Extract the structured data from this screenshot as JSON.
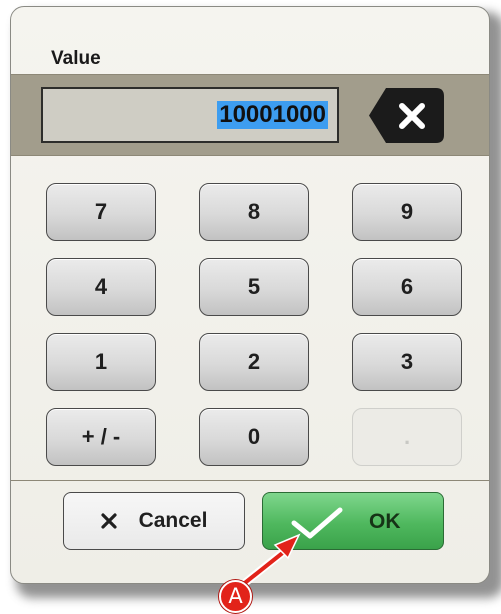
{
  "dialog": {
    "field_label": "Value",
    "value_display": "10001000",
    "value_selected": true,
    "backspace_icon": "clear-x-icon"
  },
  "keypad": {
    "rows": [
      [
        {
          "label": "7",
          "enabled": true
        },
        {
          "label": "8",
          "enabled": true
        },
        {
          "label": "9",
          "enabled": true
        }
      ],
      [
        {
          "label": "4",
          "enabled": true
        },
        {
          "label": "5",
          "enabled": true
        },
        {
          "label": "6",
          "enabled": true
        }
      ],
      [
        {
          "label": "1",
          "enabled": true
        },
        {
          "label": "2",
          "enabled": true
        },
        {
          "label": "3",
          "enabled": true
        }
      ],
      [
        {
          "label": "+ / -",
          "enabled": true
        },
        {
          "label": "0",
          "enabled": true
        },
        {
          "label": ".",
          "enabled": false
        }
      ]
    ]
  },
  "actions": {
    "cancel_label": "Cancel",
    "cancel_icon": "x-icon",
    "ok_label": "OK",
    "ok_icon": "checkmark-icon"
  },
  "annotation": {
    "badge_label": "A",
    "target": "ok-button",
    "color": "#e2231a"
  },
  "colors": {
    "ok_green": "#4fb85e",
    "selection_blue": "#3d9df0",
    "value_band": "#a29d8c"
  }
}
